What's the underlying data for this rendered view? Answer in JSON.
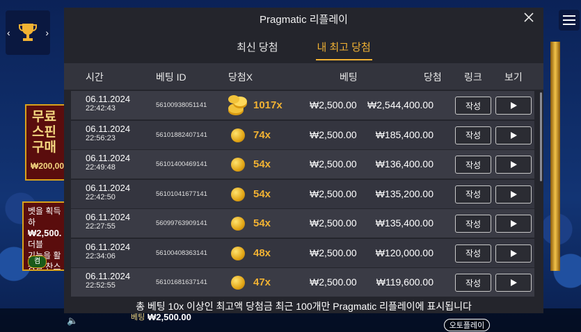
{
  "modal": {
    "title": "Pragmatic 리플레이",
    "tabs": [
      {
        "label": "최신 당첨"
      },
      {
        "label": "내 최고 당첨"
      }
    ],
    "active_tab": 1,
    "columns": {
      "time": "시간",
      "bet_id": "베팅 ID",
      "multiplier": "당첨X",
      "bet": "베팅",
      "win": "당첨",
      "link": "링크",
      "view": "보기"
    },
    "rows": [
      {
        "date": "06.11.2024",
        "time": "22:42:43",
        "bet_id": "56100938051141",
        "multiplier": "1017x",
        "bet": "₩2,500.00",
        "win": "₩2,544,400.00",
        "link_label": "작성",
        "coin": "coin-stack-icon"
      },
      {
        "date": "06.11.2024",
        "time": "22:56:23",
        "bet_id": "56101882407141",
        "multiplier": "74x",
        "bet": "₩2,500.00",
        "win": "₩185,400.00",
        "link_label": "작성",
        "coin": "coin-icon"
      },
      {
        "date": "06.11.2024",
        "time": "22:49:48",
        "bet_id": "56101400469141",
        "multiplier": "54x",
        "bet": "₩2,500.00",
        "win": "₩136,400.00",
        "link_label": "작성",
        "coin": "coin-icon"
      },
      {
        "date": "06.11.2024",
        "time": "22:42:50",
        "bet_id": "56101041677141",
        "multiplier": "54x",
        "bet": "₩2,500.00",
        "win": "₩135,200.00",
        "link_label": "작성",
        "coin": "coin-icon"
      },
      {
        "date": "06.11.2024",
        "time": "22:27:55",
        "bet_id": "56099763909141",
        "multiplier": "54x",
        "bet": "₩2,500.00",
        "win": "₩135,400.00",
        "link_label": "작성",
        "coin": "coin-icon"
      },
      {
        "date": "06.11.2024",
        "time": "22:34:06",
        "bet_id": "56100408363141",
        "multiplier": "48x",
        "bet": "₩2,500.00",
        "win": "₩120,000.00",
        "link_label": "작성",
        "coin": "coin-icon"
      },
      {
        "date": "06.11.2024",
        "time": "22:52:55",
        "bet_id": "56101681637141",
        "multiplier": "47x",
        "bet": "₩2,500.00",
        "win": "₩119,600.00",
        "link_label": "작성",
        "coin": "coin-icon"
      }
    ],
    "footer_note": "총 베팅 10x 이상인 최고액 당첨금 최근 100개만 Pragmatic 리플레이에 표시됩니다"
  },
  "game": {
    "left_panel_text": "무료 스핀 구매",
    "left_panel_price": "₩200,00",
    "left_panel2_lines": [
      "벳을 획득하",
      "₩2,500.",
      "더블",
      "기능을 활",
      "등할 찬스"
    ],
    "left_panel2_toggle": "켬",
    "bet_label": "베팅",
    "bet_value": "₩2,500.00",
    "auto_play": "오토플레이"
  },
  "colors": {
    "accent": "#f2b233",
    "modal_bg": "#24252c",
    "header_bg": "#33343d",
    "row_bg": "#3a3b45"
  }
}
